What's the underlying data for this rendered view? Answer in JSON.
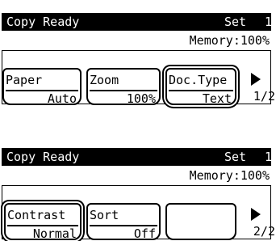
{
  "screens": [
    {
      "status": "Copy Ready",
      "mode": "Set",
      "count": "1",
      "memory": "Memory:100%",
      "buttons": [
        {
          "label": "Paper",
          "value": "Auto"
        },
        {
          "label": "Zoom",
          "value": "100%"
        },
        {
          "label": "Doc.Type",
          "value": "Text"
        }
      ],
      "page": "1/2"
    },
    {
      "status": "Copy Ready",
      "mode": "Set",
      "count": "1",
      "memory": "Memory:100%",
      "buttons": [
        {
          "label": "Contrast",
          "value": "Normal"
        },
        {
          "label": "Sort",
          "value": "Off"
        },
        {
          "label": "",
          "value": ""
        }
      ],
      "page": "2/2"
    }
  ]
}
